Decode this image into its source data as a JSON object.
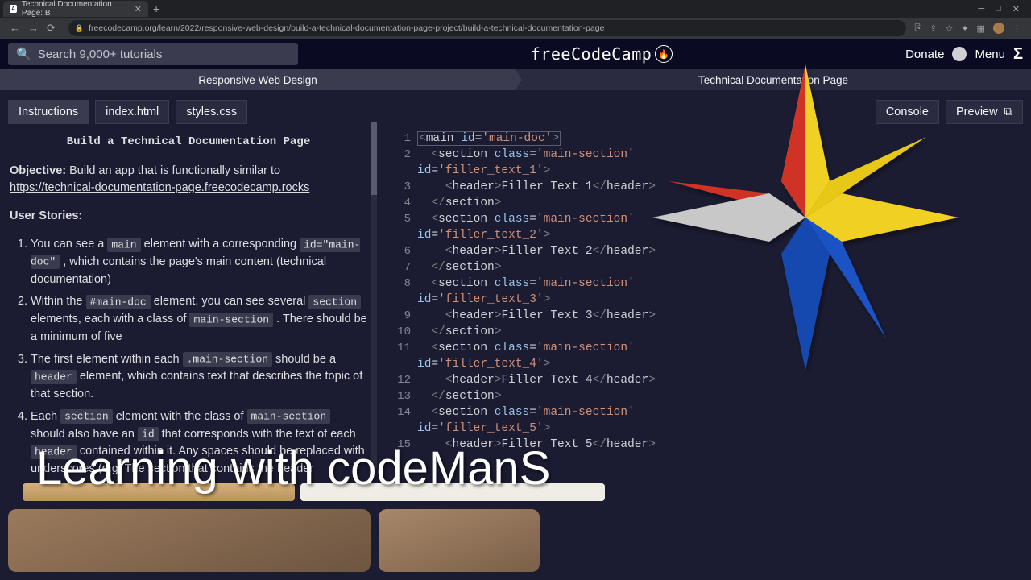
{
  "browser": {
    "tab_title": "Technical Documentation Page: B",
    "url": "freecodecamp.org/learn/2022/responsive-web-design/build-a-technical-documentation-page-project/build-a-technical-documentation-page"
  },
  "header": {
    "search_placeholder": "Search 9,000+ tutorials",
    "brand": "freeCodeCamp",
    "donate": "Donate",
    "menu": "Menu"
  },
  "crumbs": {
    "left": "Responsive Web Design",
    "right": "Technical Documentation Page"
  },
  "tabs": {
    "instructions": "Instructions",
    "indexhtml": "index.html",
    "stylescss": "styles.css",
    "console": "Console",
    "preview": "Preview"
  },
  "instructions": {
    "title": "Build a Technical Documentation Page",
    "objective_label": "Objective:",
    "objective_text": " Build an app that is functionally similar to ",
    "objective_link": "https://technical-documentation-page.freecodecamp.rocks",
    "user_stories_label": "User Stories:",
    "stories": {
      "s1a": "You can see a ",
      "s1_code1": "main",
      "s1b": " element with a corresponding ",
      "s1_code2": "id=\"main-doc\"",
      "s1c": " , which contains the page's main content (technical documentation)",
      "s2a": "Within the ",
      "s2_code1": "#main-doc",
      "s2b": " element, you can see several ",
      "s2_code2": "section",
      "s2c": " elements, each with a class of ",
      "s2_code3": "main-section",
      "s2d": " . There should be a minimum of five",
      "s3a": "The first element within each ",
      "s3_code1": ".main-section",
      "s3b": " should be a ",
      "s3_code2": "header",
      "s3c": " element, which contains text that describes the topic of that section.",
      "s4a": "Each ",
      "s4_code1": "section",
      "s4b": " element with the class of ",
      "s4_code2": "main-section",
      "s4c": " should also have an ",
      "s4_code3": "id",
      "s4d": " that corresponds with the text of each ",
      "s4_code4": "header",
      "s4e": " contained within it. Any spaces should be replaced with underscores (e.g. The section that contains the header"
    }
  },
  "editor": {
    "gutters": [
      "1",
      "2",
      "3",
      "4",
      "5",
      "6",
      "7",
      "8",
      "9",
      "10",
      "11",
      "12",
      "13",
      "14",
      "15"
    ],
    "lines": {
      "l1": "<main id='main-doc'>",
      "l2": "  <section class='main-section'\nid='filler_text_1'>",
      "l3": "    <header>Filler Text 1</header>",
      "l4": "  </section>",
      "l5": "  <section class='main-section'\nid='filler_text_2'>",
      "l6": "    <header>Filler Text 2</header>",
      "l7": "  </section>",
      "l8": "  <section class='main-section'\nid='filler_text_3'>",
      "l9": "    <header>Filler Text 3</header>",
      "l10": "  </section>",
      "l11": "  <section class='main-section'\nid='filler_text_4'>",
      "l12": "    <header>Filler Text 4</header>",
      "l13": "  </section>",
      "l14": "  <section class='main-section'\nid='filler_text_5'>",
      "l15": "    <header>Filler Text 5</header>"
    }
  },
  "overlay": {
    "channel": "Learning with codeManS"
  }
}
